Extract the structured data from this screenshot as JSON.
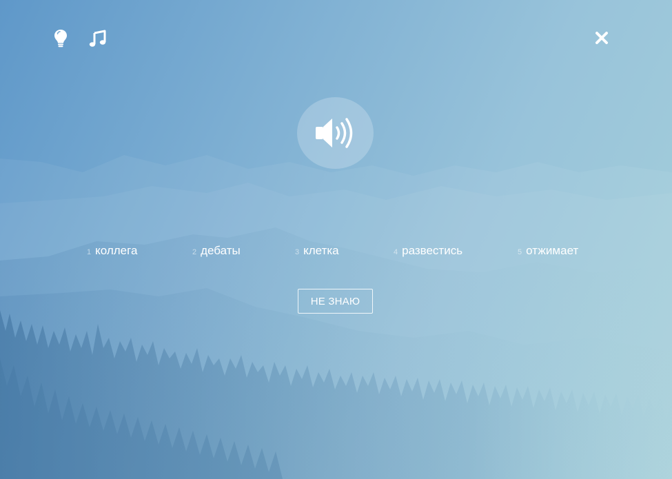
{
  "toolbar": {
    "hint_icon": "lightbulb-icon",
    "music_icon": "music-note-icon",
    "close_icon": "close-icon"
  },
  "audio": {
    "play_icon": "speaker-volume-icon"
  },
  "options": [
    {
      "number": "1",
      "word": "коллега"
    },
    {
      "number": "2",
      "word": "дебаты"
    },
    {
      "number": "3",
      "word": "клетка"
    },
    {
      "number": "4",
      "word": "развестись"
    },
    {
      "number": "5",
      "word": "отжимает"
    }
  ],
  "dont_know_label": "НЕ ЗНАЮ",
  "colors": {
    "background_left": "#5f98c9",
    "background_right": "#a6d0da",
    "text": "#ffffff"
  }
}
